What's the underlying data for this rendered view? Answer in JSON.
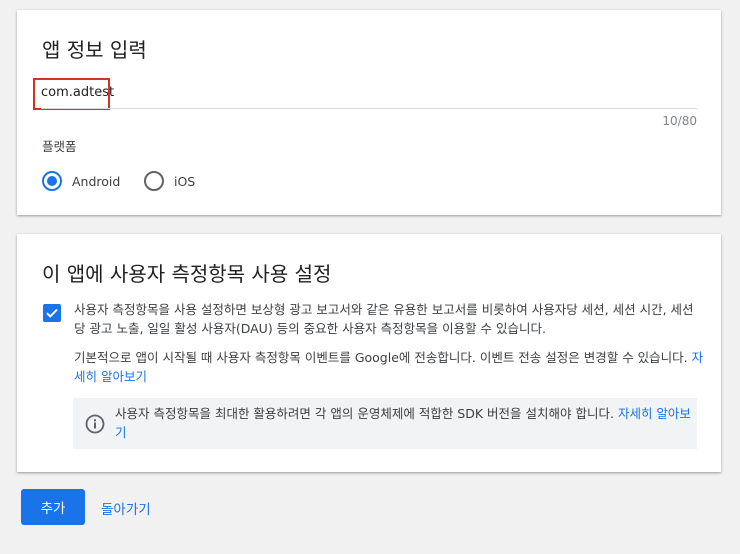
{
  "app_info": {
    "title": "앱 정보 입력",
    "package_value": "com.adtest",
    "counter": "10/80",
    "platform_label": "플랫폼",
    "platforms": [
      {
        "label": "Android",
        "selected": true
      },
      {
        "label": "iOS",
        "selected": false
      }
    ]
  },
  "metrics": {
    "title": "이 앱에 사용자 측정항목 사용 설정",
    "checkbox_checked": true,
    "paragraph1": "사용자 측정항목을 사용 설정하면 보상형 광고 보고서와 같은 유용한 보고서를 비롯하여 사용자당 세션, 세션 시간, 세션당 광고 노출, 일일 활성 사용자(DAU) 등의 중요한 사용자 측정항목을 이용할 수 있습니다.",
    "paragraph2": "기본적으로 앱이 시작될 때 사용자 측정항목 이벤트를 Google에 전송합니다. 이벤트 전송 설정은 변경할 수 있습니다.",
    "paragraph2_link": "자세히 알아보기",
    "info_text": "사용자 측정항목을 최대한 활용하려면 각 앱의 운영체제에 적합한 SDK 버전을 설치해야 합니다.",
    "info_link": "자세히 알아보기"
  },
  "actions": {
    "add_label": "추가",
    "back_label": "돌아가기"
  },
  "colors": {
    "accent": "#1a73e8",
    "highlight": "#d93025"
  }
}
